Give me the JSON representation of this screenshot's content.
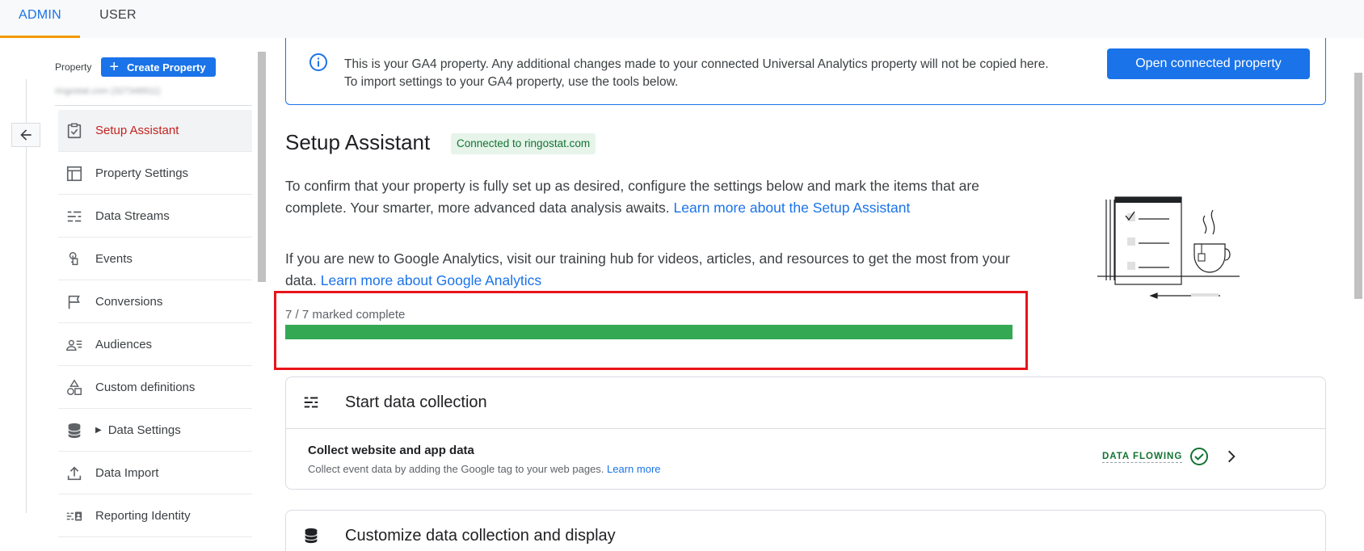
{
  "tabs": [
    {
      "label": "ADMIN",
      "active": true
    },
    {
      "label": "USER",
      "active": false
    }
  ],
  "sidebar": {
    "property_label": "Property",
    "create_button": "Create Property",
    "property_name": "ringostat.com (327348911)",
    "items": [
      {
        "label": "Setup Assistant",
        "icon": "clipboard-check-icon",
        "active": true
      },
      {
        "label": "Property Settings",
        "icon": "layout-icon"
      },
      {
        "label": "Data Streams",
        "icon": "data-streams-icon"
      },
      {
        "label": "Events",
        "icon": "touch-icon"
      },
      {
        "label": "Conversions",
        "icon": "flag-icon"
      },
      {
        "label": "Audiences",
        "icon": "audience-icon"
      },
      {
        "label": "Custom definitions",
        "icon": "shapes-icon"
      },
      {
        "label": "Data Settings",
        "icon": "database-icon",
        "expandable": true
      },
      {
        "label": "Data Import",
        "icon": "upload-icon"
      },
      {
        "label": "Reporting Identity",
        "icon": "identity-icon"
      }
    ]
  },
  "banner": {
    "line1": "This is your GA4 property. Any additional changes made to your connected Universal Analytics property will not be copied here.",
    "line2": "To import settings to your GA4 property, use the tools below.",
    "button": "Open connected property"
  },
  "main": {
    "title": "Setup Assistant",
    "badge": "Connected to ringostat.com",
    "desc1_text": "To confirm that your property is fully set up as desired, configure the settings below and mark the items that are complete. Your smarter, more advanced data analysis awaits. ",
    "desc1_link": "Learn more about the Setup Assistant",
    "desc2_text": "If you are new to Google Analytics, visit our training hub for videos, articles, and resources to get the most from your data. ",
    "desc2_link": "Learn more about Google Analytics",
    "progress_label": "7 / 7 marked complete",
    "progress_fraction": 1.0,
    "highlight_color": "#e8141a"
  },
  "cards": [
    {
      "title": "Start data collection",
      "icon": "data-streams-icon",
      "rows": [
        {
          "title": "Collect website and app data",
          "subtitle": "Collect event data by adding the Google tag to your web pages. ",
          "link": "Learn more",
          "status": "DATA FLOWING"
        }
      ]
    },
    {
      "title": "Customize data collection and display",
      "icon": "database-icon"
    }
  ],
  "colors": {
    "accent": "#1a73e8",
    "success": "#34a853",
    "active_nav": "#c5221f",
    "tab_indicator": "#f29900"
  }
}
